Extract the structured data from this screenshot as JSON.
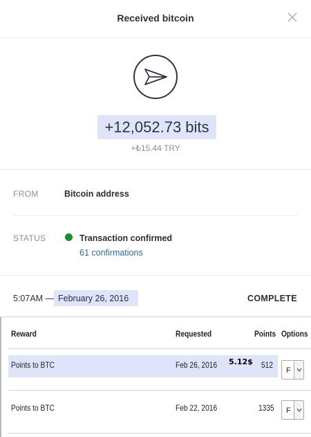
{
  "header": {
    "title": "Received bitcoin"
  },
  "transaction": {
    "amount": "+12,052.73 bits",
    "fiat": "+₺15.44 TRY"
  },
  "details": {
    "from_label": "FROM",
    "from_value": "Bitcoin address",
    "status_label": "STATUS",
    "status_value": "Transaction confirmed",
    "confirmations": "61 confirmations",
    "status_color": "#1a8f2c"
  },
  "footer": {
    "time": "5:07AM —",
    "date": "February 26, 2016",
    "state": "COMPLETE"
  },
  "rewards_table": {
    "columns": [
      "Reward",
      "Requested",
      "Points",
      "Options"
    ],
    "rows": [
      {
        "reward": "Points to BTC",
        "requested": "Feb 26, 2016",
        "points": "512",
        "option": "F",
        "badge": "5.12$"
      },
      {
        "reward": "Points to BTC",
        "requested": "Feb 22, 2016",
        "points": "1335",
        "option": "F"
      }
    ]
  },
  "colors": {
    "highlight": "#dfe4fb",
    "link": "#2b6cb0"
  }
}
